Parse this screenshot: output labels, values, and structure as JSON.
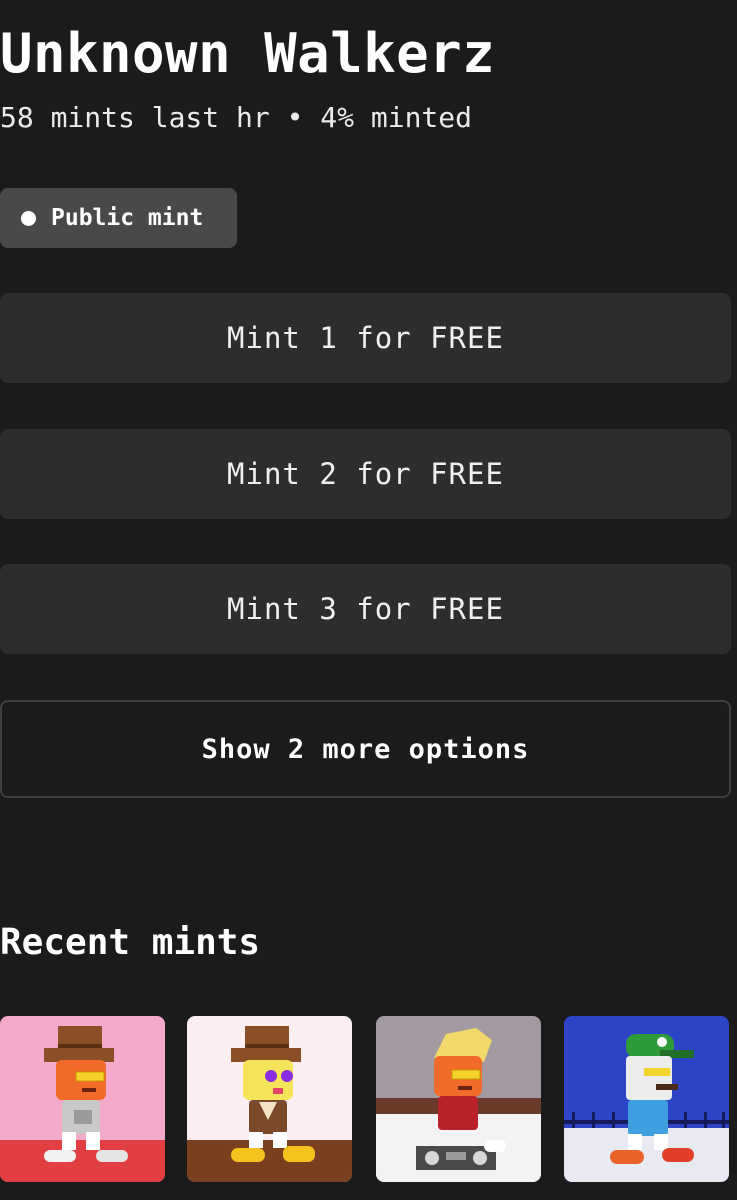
{
  "collection": {
    "title": "Unknown Walkerz",
    "stats": "58 mints last hr • 4% minted"
  },
  "phase_badge": {
    "label": "Public mint"
  },
  "mint_options": [
    {
      "label": "Mint 1 for FREE"
    },
    {
      "label": "Mint 2 for FREE"
    },
    {
      "label": "Mint 3 for FREE"
    }
  ],
  "more_options": {
    "label": "Show 2 more options"
  },
  "recent_mints": {
    "heading": "Recent mints",
    "items": [
      {
        "name": "walker-cowboy-gray-shirt",
        "background": "#f6aacb",
        "floor": "#e23f43"
      },
      {
        "name": "walker-cowboy-brown-jacket",
        "background": "#fbeef0",
        "floor": "#7a3f1e"
      },
      {
        "name": "walker-blonde-boombox",
        "background": "#a29aa0",
        "floor": "#f4f2f4"
      },
      {
        "name": "walker-green-cap-blue-shirt",
        "background": "#2d44c6",
        "floor": "#e9e9f2"
      }
    ]
  }
}
